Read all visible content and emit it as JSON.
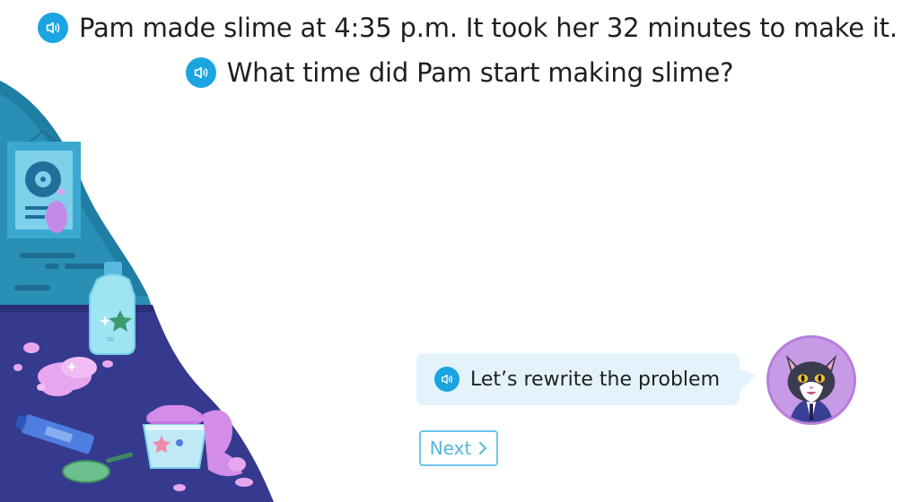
{
  "question": {
    "line1": "Pam made slime at 4:35 p.m. It took her 32 minutes to make it.",
    "line2": "What time did Pam start making slime?"
  },
  "hint": {
    "text": "Let’s rewrite the problem"
  },
  "actions": {
    "next_label": "Next"
  },
  "icons": {
    "audio": "speaker-icon",
    "next": "chevron-right-icon"
  },
  "colors": {
    "accent": "#1aa5e0",
    "bubble": "#e4f3fb",
    "next_border": "#6cc7ea",
    "scene_dark": "#3a3f96",
    "scene_teal": "#2a93b8"
  }
}
